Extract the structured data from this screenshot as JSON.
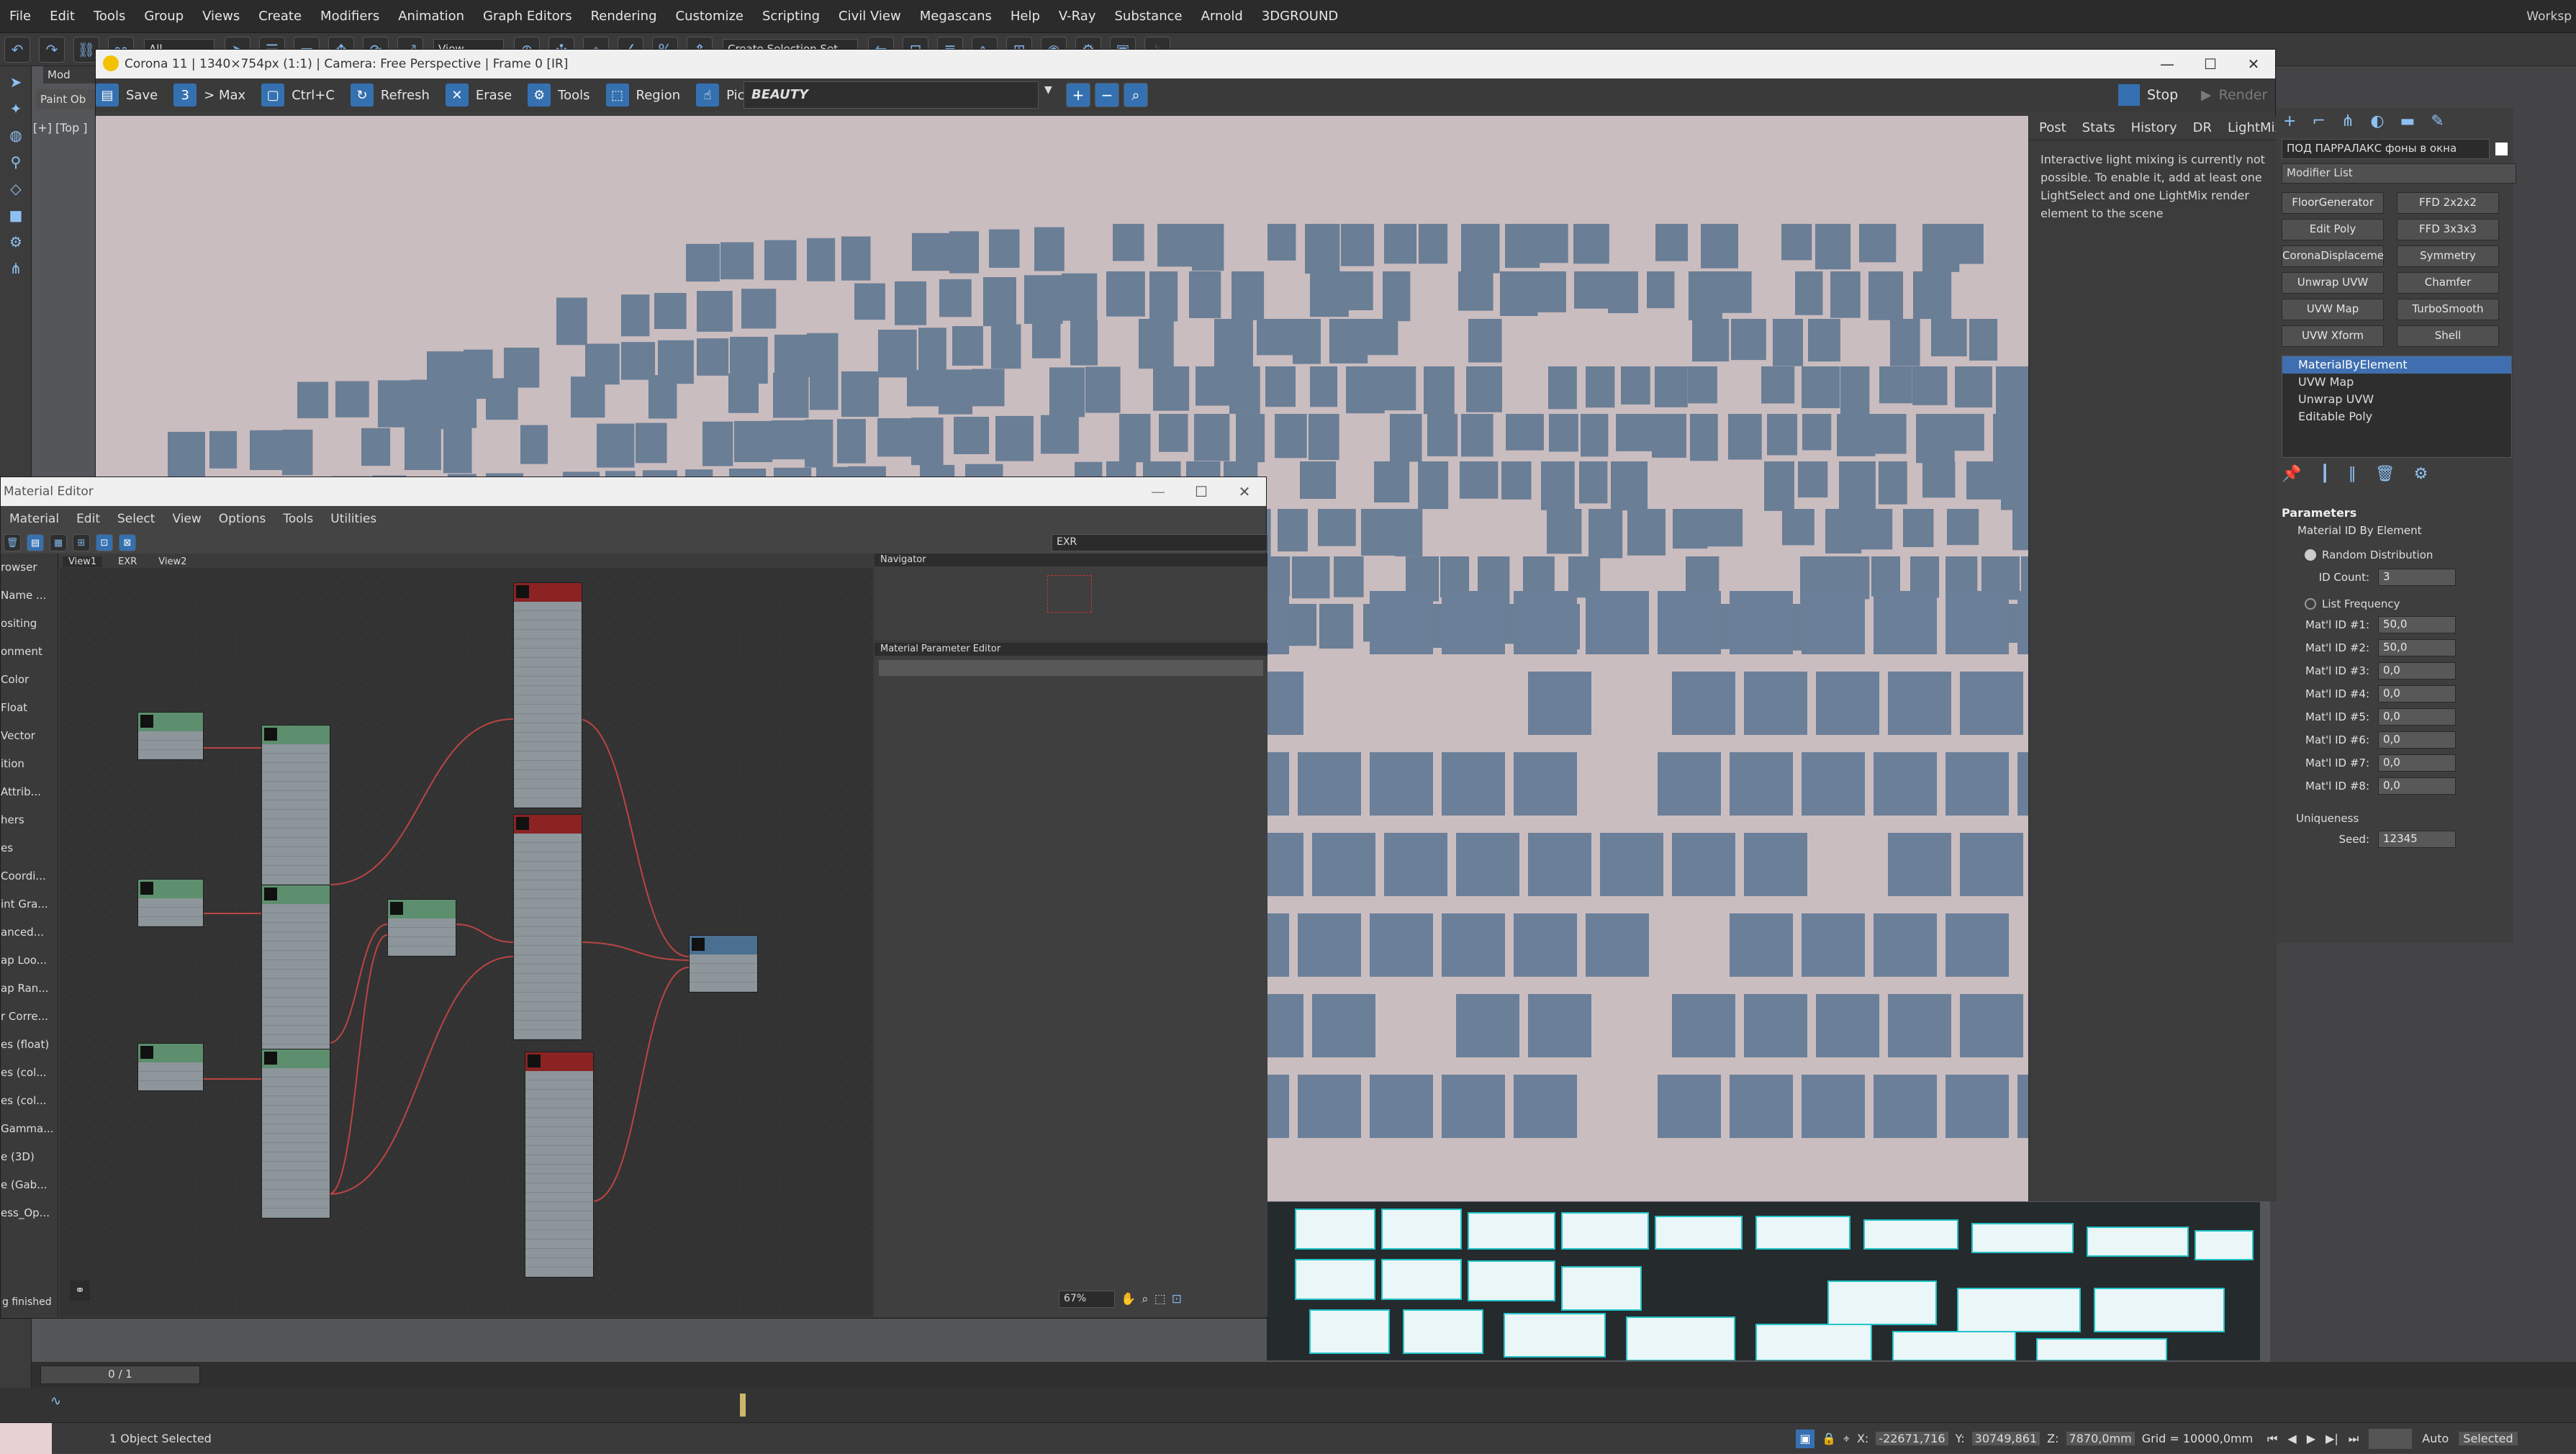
{
  "menubar": {
    "items": [
      "File",
      "Edit",
      "Tools",
      "Group",
      "Views",
      "Create",
      "Modifiers",
      "Animation",
      "Graph Editors",
      "Rendering",
      "Customize",
      "Scripting",
      "Civil View",
      "Megascans",
      "Help",
      "V-Ray",
      "Substance",
      "Arnold",
      "3DGROUND"
    ],
    "workspace": "Worksp"
  },
  "main_toolbar": {
    "selection_filter": "All",
    "view": "View",
    "selection_set": "Create Selection Set"
  },
  "viewport": {
    "label": "[+] [Top ]",
    "paint_label": "Paint Ob",
    "mode_label": "Mod"
  },
  "corona": {
    "title": "Corona 11 | 1340×754px (1:1) | Camera: Free Perspective | Frame 0 [IR]",
    "toolbar": {
      "save": "Save",
      "max": "> Max",
      "copy": "Ctrl+C",
      "refresh": "Refresh",
      "erase": "Erase",
      "tools": "Tools",
      "region": "Region",
      "pick": "Pick",
      "pass": "BEAUTY",
      "stop": "Stop",
      "render": "Render"
    },
    "tabs": [
      "Post",
      "Stats",
      "History",
      "DR",
      "LightMix"
    ],
    "message": "Interactive light mixing is currently not possible. To enable it, add at least one LightSelect and one LightMix render element to the scene"
  },
  "command_panel": {
    "object_name": "ПОД ПАРРАЛАКС фоны в окна",
    "modifier_list": "Modifier List",
    "modifier_buttons": [
      "FloorGenerator",
      "FFD 2x2x2",
      "Edit Poly",
      "FFD 3x3x3",
      "CoronaDisplacementMo",
      "Symmetry",
      "Unwrap UVW",
      "Chamfer",
      "UVW Map",
      "TurboSmooth",
      "UVW Xform",
      "Shell"
    ],
    "stack": [
      "MaterialByElement",
      "UVW Map",
      "Unwrap UVW",
      "Editable Poly"
    ],
    "rollout_title": "Parameters",
    "group_title": "Material ID By Element",
    "random_distribution": "Random Distribution",
    "id_count_label": "ID Count:",
    "id_count": "3",
    "list_frequency": "List Frequency",
    "mat_ids": [
      {
        "label": "Mat'l ID #1:",
        "value": "50,0"
      },
      {
        "label": "Mat'l ID #2:",
        "value": "50,0"
      },
      {
        "label": "Mat'l ID #3:",
        "value": "0,0"
      },
      {
        "label": "Mat'l ID #4:",
        "value": "0,0"
      },
      {
        "label": "Mat'l ID #5:",
        "value": "0,0"
      },
      {
        "label": "Mat'l ID #6:",
        "value": "0,0"
      },
      {
        "label": "Mat'l ID #7:",
        "value": "0,0"
      },
      {
        "label": "Mat'l ID #8:",
        "value": "0,0"
      }
    ],
    "uniqueness": "Uniqueness",
    "seed_label": "Seed:",
    "seed": "12345"
  },
  "material_editor": {
    "title": "Material Editor",
    "menu": [
      "Material",
      "Edit",
      "Select",
      "View",
      "Options",
      "Tools",
      "Utilities"
    ],
    "view_tabs": [
      "View1",
      "EXR",
      "View2"
    ],
    "view_dropdown": "EXR",
    "browser_items": [
      "rowser",
      "Name ...",
      "ositing",
      "onment",
      "Color",
      "Float",
      "Vector",
      "ition",
      "Attrib...",
      "hers",
      "es",
      "Coordi...",
      "int Gra...",
      "anced...",
      "ap Loo...",
      "ap Ran...",
      "r Corre...",
      "es (float)",
      "es (col...",
      "es (col...",
      "Gamma...",
      "e (3D)",
      "e (Gab...",
      "ess_Op..."
    ],
    "navigator": "Navigator",
    "param_editor": "Material Parameter Editor",
    "zoom": "67%",
    "status": "g finished"
  },
  "timeline": {
    "frame": "0 / 1"
  },
  "status": {
    "objects": "1 Object Selected",
    "x": "-22671,716",
    "y": "30749,861",
    "z": "7870,0mm",
    "grid": "Grid = 10000,0mm",
    "key_mode": "Auto",
    "selected": "Selected"
  },
  "colors": {
    "accent": "#3571b0",
    "render_bg": "#cabdbf",
    "panel_bg": "#3e3e3e",
    "stack_selected": "#3f6fb0"
  }
}
